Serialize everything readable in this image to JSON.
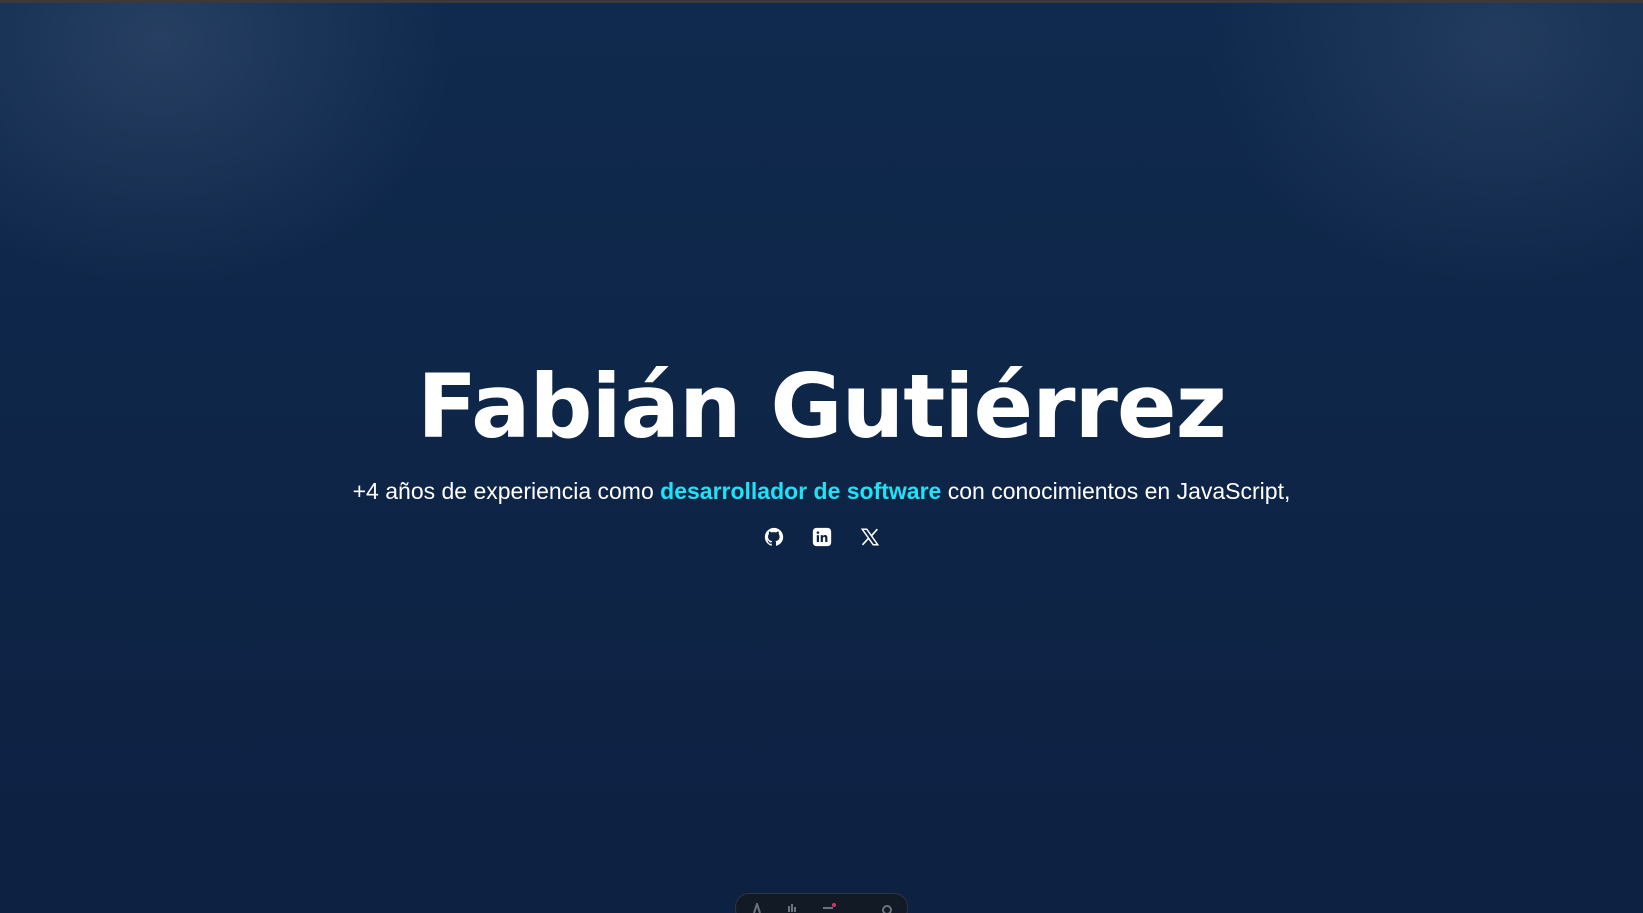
{
  "hero": {
    "name": "Fabián Gutiérrez",
    "subtitle_before": "+4 años de experiencia como ",
    "subtitle_highlight": "desarrollador de software",
    "subtitle_after": " con conocimientos en JavaScript,"
  },
  "colors": {
    "background": "#0d2447",
    "accent": "#1fe2f5",
    "text": "#ffffff"
  },
  "socials": [
    {
      "icon": "github-icon"
    },
    {
      "icon": "linkedin-icon"
    },
    {
      "icon": "x-twitter-icon"
    }
  ],
  "dock": {
    "icons": [
      "astro-icon",
      "inspect-icon",
      "audit-icon",
      "settings-icon"
    ]
  }
}
